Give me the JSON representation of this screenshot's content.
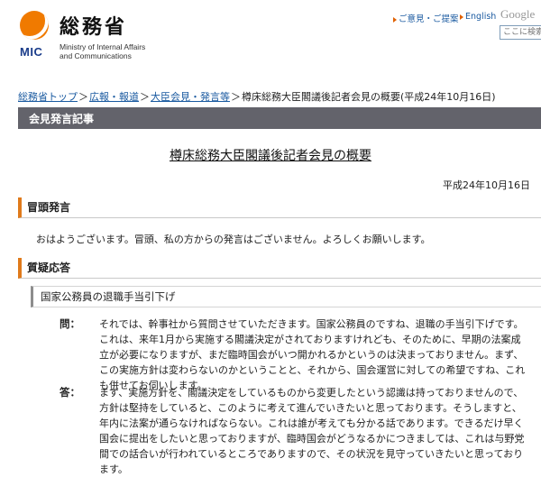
{
  "header": {
    "logo_ja": "総務省",
    "logo_mic": "MIC",
    "logo_en": "Ministry of Internal Affairs\nand Communications",
    "link_feedback": "ご意見・ご提案",
    "link_english": "English",
    "google_label": "Google",
    "search_placeholder": "ここに検索"
  },
  "breadcrumb": {
    "items": [
      "総務省トップ",
      "広報・報道",
      "大臣会見・発言等"
    ],
    "current": "樽床総務大臣閣議後記者会見の概要(平成24年10月16日)"
  },
  "section_bar": "会見発言記事",
  "page_title": "樽床総務大臣閣議後記者会見の概要",
  "date": "平成24年10月16日",
  "opening": {
    "heading": "冒頭発言",
    "text": "おはようございます。冒頭、私の方からの発言はございません。よろしくお願いします。"
  },
  "qa": {
    "heading": "質疑応答",
    "topic": "国家公務員の退職手当引下げ",
    "q_label": "問：",
    "q_text": "それでは、幹事社から質問させていただきます。国家公務員のですね、退職の手当引下げです。これは、来年1月から実施する閣議決定がされておりますけれども、そのために、早期の法案成立が必要になりますが、まだ臨時国会がいつ開かれるかというのは決まっておりません。まず、この実施方針は変わらないのかということと、それから、国会運営に対しての希望ですね、これも併せてお伺いします。",
    "a_label": "答：",
    "a_text": "まず、実施方針を、閣議決定をしているものから変更したという認識は持っておりませんので、方針は堅持をしていると、このように考えて進んでいきたいと思っております。そうしますと、年内に法案が通らなければならない。これは誰が考えても分かる話であります。できるだけ早く国会に提出をしたいと思っておりますが、臨時国会がどうなるかにつきましては、これは与野党間での話合いが行われているところでありますので、その状況を見守っていきたいと思っております。"
  },
  "colors": {
    "accent_orange": "#f07a00",
    "link_blue": "#1a5aa0",
    "section_bar_gray": "#63636b"
  }
}
